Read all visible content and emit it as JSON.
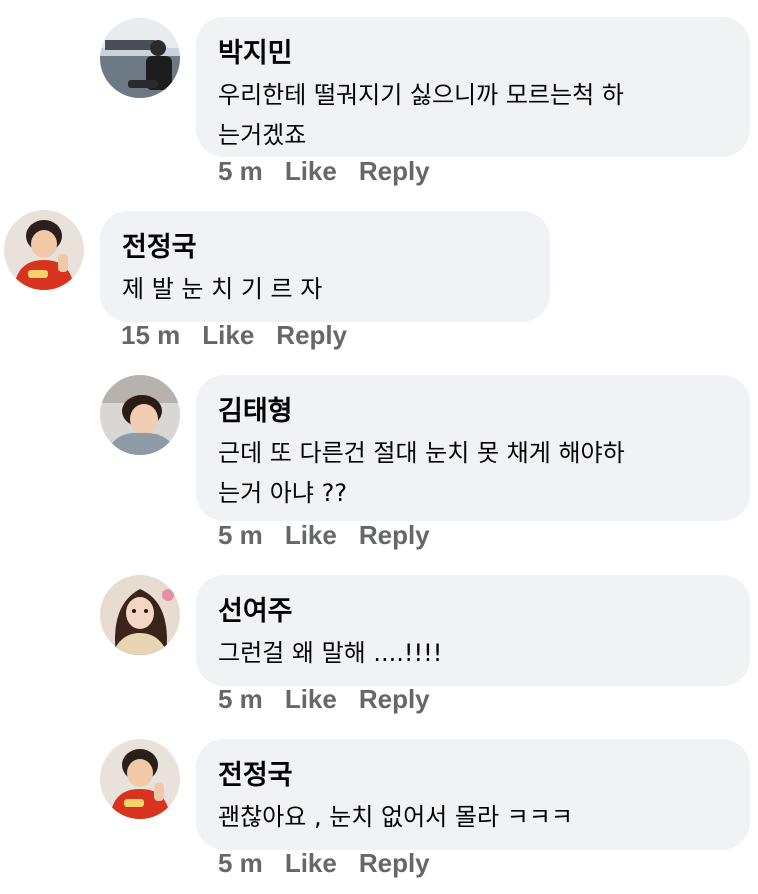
{
  "comments": [
    {
      "author": "박지민",
      "lines": [
        "우리한테 떨궈지기 싫으니까 모르는척 하",
        "는거겠죠"
      ],
      "time": "5 m",
      "like_label": "Like",
      "reply_label": "Reply",
      "avatar_icon": "avatar-photo-icon"
    },
    {
      "author": "전정국",
      "lines": [
        "제 발 눈 치 기 르 자"
      ],
      "time": "15 m",
      "like_label": "Like",
      "reply_label": "Reply",
      "avatar_icon": "avatar-photo-icon"
    },
    {
      "author": "김태형",
      "lines": [
        "근데 또 다른건 절대 눈치 못 채게 해야하",
        "는거 아냐 ??"
      ],
      "time": "5 m",
      "like_label": "Like",
      "reply_label": "Reply",
      "avatar_icon": "avatar-photo-icon"
    },
    {
      "author": "선여주",
      "lines": [
        "그런걸 왜 말해 ....!!!!"
      ],
      "time": "5 m",
      "like_label": "Like",
      "reply_label": "Reply",
      "avatar_icon": "avatar-photo-icon"
    },
    {
      "author": "전정국",
      "lines": [
        "괜찮아요 , 눈치 없어서 몰라 ㅋㅋㅋ"
      ],
      "time": "5 m",
      "like_label": "Like",
      "reply_label": "Reply",
      "avatar_icon": "avatar-photo-icon"
    }
  ],
  "colors": {
    "bubble": "#f0f2f5",
    "text": "#050505",
    "meta": "#65676b"
  }
}
